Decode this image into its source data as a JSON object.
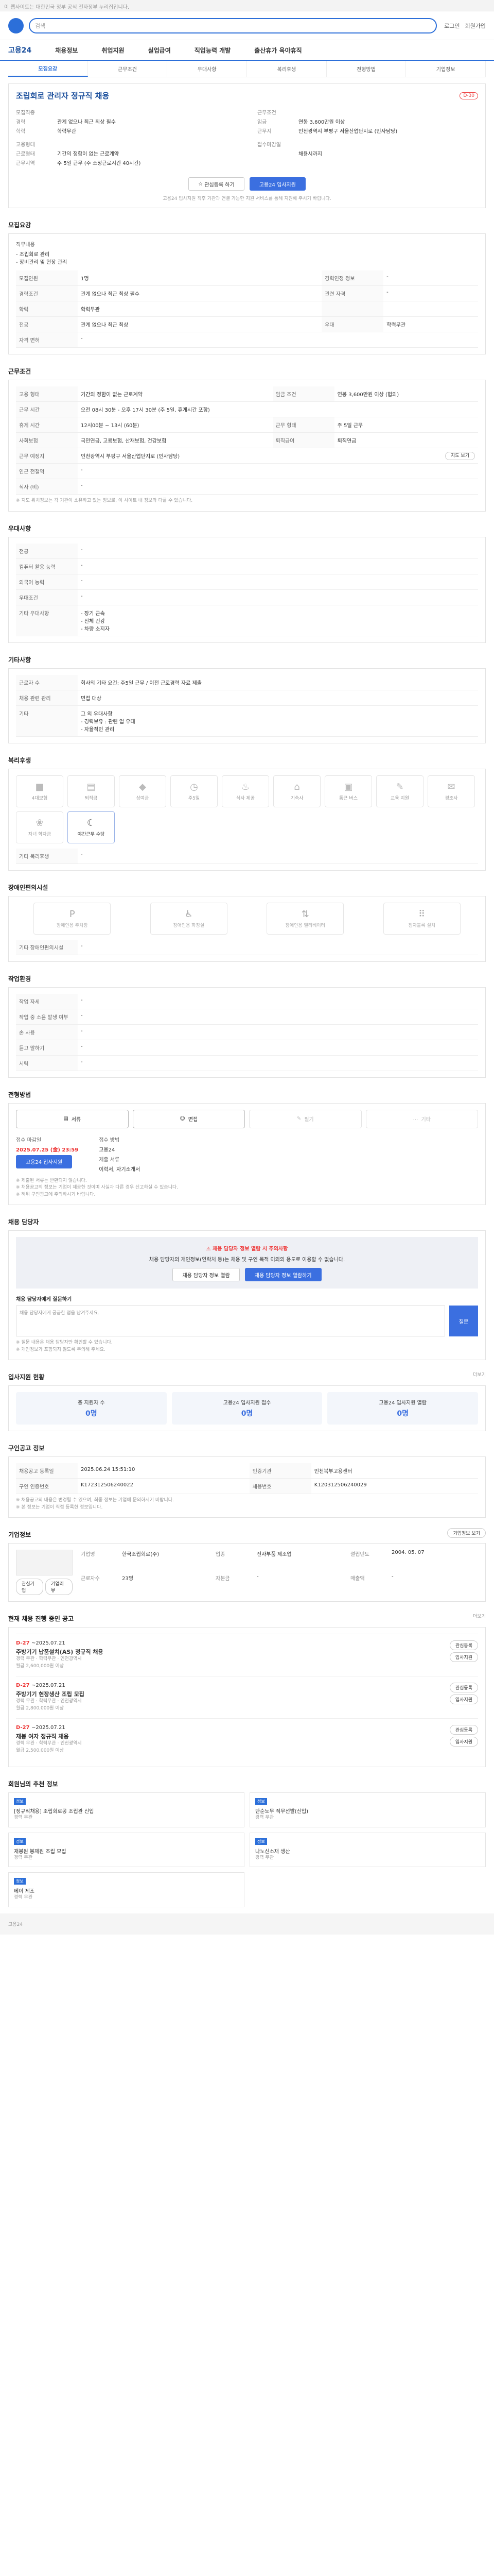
{
  "topbar": {
    "text": "이 웹사이트는 대한민국 정부 공식 전자정부 누리집입니다."
  },
  "header": {
    "search_placeholder": "검색",
    "links": [
      "로그인",
      "회원가입"
    ]
  },
  "nav": {
    "brand": "고용24",
    "items": [
      "채용정보",
      "취업지원",
      "실업급여",
      "직업능력 개발",
      "출산휴가 육아휴직"
    ]
  },
  "tabs": [
    "모집요강",
    "근무조건",
    "우대사항",
    "복리후생",
    "전형방법",
    "기업정보"
  ],
  "job": {
    "title": "조립회로 관리자 정규직 채용",
    "badge": "D-30",
    "left": [
      {
        "k": "모집직종",
        "v": ""
      },
      {
        "k": "경력",
        "v": "관계 없으나 최근 최상 필수"
      },
      {
        "k": "학력",
        "v": "학력무관"
      }
    ],
    "left2": [
      {
        "k": "고용형태",
        "v": ""
      },
      {
        "k": "근로형태",
        "v": "기간의 정함이 없는 근로계약"
      },
      {
        "k": "근무지역",
        "v": "주 5일 근무 (주 소정근로시간 40시간)"
      }
    ],
    "right": [
      {
        "k": "근무조건",
        "v": ""
      },
      {
        "k": "임금",
        "v": "연봉 3,600만원 이상"
      },
      {
        "k": "근무지",
        "v": "인천광역시 부평구 서울산업단지로 (인사담당)"
      }
    ],
    "right2": [
      {
        "k": "접수마감일",
        "v": ""
      },
      {
        "k": "",
        "v": "채용시까지"
      }
    ],
    "btn_interest": "관심등록 하기",
    "btn_apply": "고용24 입사지원",
    "note": "고용24 입사지원 직후 기관과 연결 가능한 지원 서비스를 통해 지원해 주시기 바랍니다."
  },
  "recruit": {
    "title": "모집요강",
    "duties_k": "직무내용",
    "duties": [
      "- 조립회로 관리",
      "- 장비관리 및 현장 관리"
    ],
    "rows": [
      {
        "k": "모집인원",
        "v": "1명",
        "k2": "경력인정 정보",
        "v2": "-"
      },
      {
        "k": "경력조건",
        "v": "관계 없으나 최근 최상 필수",
        "k2": "관련 자격",
        "v2": "-"
      },
      {
        "k": "학력",
        "v": "학력무관",
        "k2": "",
        "v2": ""
      },
      {
        "k": "전공",
        "v": "관계 없으나 최근 최상",
        "k2": "우대",
        "v2": "학력무관"
      },
      {
        "k": "자격 면허",
        "v": "-",
        "k2": "",
        "v2": ""
      }
    ]
  },
  "conditions": {
    "title": "근무조건",
    "rows": [
      {
        "k": "고용 형태",
        "v": "기간의 정함이 없는 근로계약",
        "k2": "임금 조건",
        "v2": "연봉 3,600만원 이상 (협의)"
      },
      {
        "k": "근무 시간",
        "v": "오전 08시 30분 - 오후 17시 30분 (주 5일, 휴게시간 포함)",
        "k2": "",
        "v2": ""
      },
      {
        "k": "휴게 시간",
        "v": "12시00분 ~ 13시 (60분)",
        "k2": "근무 형태",
        "v2": "주 5일 근무"
      },
      {
        "k": "사회보험",
        "v": "국민연금, 고용보험, 산재보험, 건강보험",
        "k2": "퇴직급여",
        "v2": "퇴직연금"
      },
      {
        "k": "근무 예정지",
        "v": "인천광역시 부평구 서울산업단지로 (인사담당)",
        "k2": "",
        "v2": ""
      },
      {
        "k": "인근 전철역",
        "v": "-",
        "k2": "",
        "v2": ""
      },
      {
        "k": "식사 (비)",
        "v": "-",
        "k2": "",
        "v2": ""
      }
    ],
    "map_btn": "지도 보기",
    "note": "※ 지도 위치정보는 각 기관이 소유하고 있는 정보로, 이 사이트 내 정보와 다를 수 있습니다."
  },
  "prefer": {
    "title": "우대사항",
    "rows": [
      {
        "k": "전공",
        "v": "-"
      },
      {
        "k": "컴퓨터 활용 능력",
        "v": "-"
      },
      {
        "k": "외국어 능력",
        "v": "-"
      },
      {
        "k": "우대조건",
        "v": "-"
      },
      {
        "k": "기타 우대사항",
        "v": "- 장기 근속\n- 신체 건강\n- 차량 소지자"
      }
    ]
  },
  "other": {
    "title": "기타사항",
    "rows": [
      {
        "k": "근로자 수",
        "v": "회사의 기타 요건: 주5일 근무 / 이전 근로경력 자료 제출"
      },
      {
        "k": "채용 관련 관리",
        "v": "면접 대상"
      },
      {
        "k": "기타",
        "v": "그 외 우대사항\n- 경력보유 : 관련 업 우대\n- 자율적인 관리"
      }
    ]
  },
  "benefits": {
    "title": "복리후생",
    "items": [
      {
        "label": "4대보험",
        "icon": "■",
        "on": false
      },
      {
        "label": "퇴직금",
        "icon": "▤",
        "on": false
      },
      {
        "label": "상여금",
        "icon": "◆",
        "on": false
      },
      {
        "label": "주5일",
        "icon": "◷",
        "on": false
      },
      {
        "label": "식사 제공",
        "icon": "♨",
        "on": false
      },
      {
        "label": "기숙사",
        "icon": "⌂",
        "on": false
      },
      {
        "label": "통근 버스",
        "icon": "▣",
        "on": false
      },
      {
        "label": "교육 지원",
        "icon": "✎",
        "on": false
      },
      {
        "label": "경조사",
        "icon": "✉",
        "on": false
      },
      {
        "label": "자녀 학자금",
        "icon": "❀",
        "on": false
      },
      {
        "label": "야간근무 수당",
        "icon": "☾",
        "on": true
      }
    ],
    "other_k": "기타 복리후생",
    "other_v": "-"
  },
  "facility": {
    "title": "장애인편의시설",
    "items": [
      "장애인용 주차장",
      "장애인용 화장실",
      "장애인용 엘리베이터",
      "점자블록 설치"
    ],
    "other_k": "기타 장애인편의시설",
    "other_v": "-"
  },
  "workenv": {
    "title": "작업환경",
    "rows": [
      {
        "k": "작업 자세",
        "v": "-",
        "k2": "",
        "v2": ""
      },
      {
        "k": "작업 중 소음 발생 여부",
        "v": "-",
        "k2": "",
        "v2": ""
      },
      {
        "k": "손 사용",
        "v": "-",
        "k2": "",
        "v2": ""
      },
      {
        "k": "듣고 말하기",
        "v": "-",
        "k2": "",
        "v2": ""
      },
      {
        "k": "시력",
        "v": "-",
        "k2": "",
        "v2": ""
      }
    ]
  },
  "selection": {
    "title": "전형방법",
    "methods": [
      {
        "label": "서류",
        "icon": "▤",
        "on": true
      },
      {
        "label": "면접",
        "icon": "☺",
        "on": true
      },
      {
        "label": "필기",
        "icon": "✎",
        "on": false
      },
      {
        "label": "기타",
        "icon": "…",
        "on": false
      }
    ],
    "deadline_k": "접수 마감일",
    "deadline_v": "2025.07.25 (金) 23:59",
    "apply_k": "접수 방법",
    "apply_v": "고용24",
    "docs_k": "제출 서류",
    "docs_v": "이력서, 자기소개서",
    "btn": "고용24 입사지원",
    "notes": "※ 제출된 서류는 반환되지 않습니다.\n※ 채용공고의 정보는 기업이 제공한 것이며 사실과 다른 경우 신고하실 수 있습니다.\n※ 허위 구인광고에 주의하시기 바랍니다."
  },
  "manager": {
    "title": "채용 담당자",
    "warn_t": "채용 담당자 정보 열람 시 주의사항",
    "warn_v": "채용 담당자의 개인정보(연락처 등)는 채용 및 구인 목적 이외의 용도로 이용할 수 없습니다.",
    "btn1": "채용 담당자 정보 열람",
    "btn2": "채용 담당자 정보 열람하기",
    "qa_title": "채용 담당자에게 질문하기",
    "qa_placeholder": "채용 담당자에게 궁금한 점을 남겨주세요.",
    "qa_btn": "질문",
    "qa_notes": "※ 질문 내용은 채용 담당자만 확인할 수 있습니다.\n※ 개인정보가 포함되지 않도록 주의해 주세요."
  },
  "status": {
    "title": "입사지원 현황",
    "more": "더보기",
    "items": [
      {
        "label": "총 지원자 수",
        "n": "0명"
      },
      {
        "label": "고용24 입사지원 접수",
        "n": "0명"
      },
      {
        "label": "고용24 입사지원 열람",
        "n": "0명"
      }
    ]
  },
  "posting": {
    "title": "구인공고 정보",
    "rows": [
      {
        "k": "채용공고 등록일",
        "v": "2025.06.24 15:51:10",
        "k2": "인증기관",
        "v2": "인천북부고용센터"
      },
      {
        "k": "구인 인증번호",
        "v": "K172312506240022",
        "k2": "채용번호",
        "v2": "K120312506240029"
      }
    ],
    "notes": "※ 채용공고의 내용은 변경될 수 있으며, 최종 정보는 기업에 문의하시기 바랍니다.\n※ 본 정보는 기업이 직접 등록한 정보입니다."
  },
  "company": {
    "title": "기업정보",
    "btn_more": "기업정보 보기",
    "fields": [
      {
        "k": "기업명",
        "v": "한국조립회로(주)"
      },
      {
        "k": "업종",
        "v": "전자부품 제조업"
      },
      {
        "k": "설립년도",
        "v": "2004. 05. 07"
      },
      {
        "k": "근로자수",
        "v": "23명"
      },
      {
        "k": "자본금",
        "v": "-"
      },
      {
        "k": "매출액",
        "v": "-"
      }
    ],
    "actions": [
      "관심기업",
      "기업리뷰"
    ]
  },
  "related": {
    "title": "현재 채용 진행 중인 공고",
    "more": "더보기",
    "items": [
      {
        "d": "D-27",
        "date": "~2025.07.21",
        "t": "주방기기 납품설치(AS) 정규직 채용",
        "meta": "경력 무관 · 학력무관 · 인천광역시",
        "pay": "월급 2,600,000원 이상"
      },
      {
        "d": "D-27",
        "date": "~2025.07.21",
        "t": "주방기기 현장생산 조립 모집",
        "meta": "경력 무관 · 학력무관 · 인천광역시",
        "pay": "월급 2,800,000원 이상"
      },
      {
        "d": "D-27",
        "date": "~2025.07.21",
        "t": "재봉 여자 정규직 채용",
        "meta": "경력 무관 · 학력무관 · 인천광역시",
        "pay": "월급 2,500,000원 이상"
      }
    ],
    "btns": [
      "관심등록",
      "입사지원"
    ]
  },
  "recommend": {
    "title": "회원님의 추천 정보",
    "items": [
      {
        "tag": "정보",
        "t": "[정규직채용] 조립회로공 조립관 신입",
        "s": "경력 무관"
      },
      {
        "tag": "정보",
        "t": "단순노무 직무선발(신입)",
        "s": "경력 무관"
      },
      {
        "tag": "정보",
        "t": "재봉원 봉제원 조립 모집",
        "s": "경력 무관"
      },
      {
        "tag": "정보",
        "t": "나노신소재 생산",
        "s": "경력 무관"
      },
      {
        "tag": "정보",
        "t": "베이 제조",
        "s": "경력 무관"
      }
    ]
  },
  "colors": {
    "primary": "#3b6fe0",
    "accent": "#e33"
  }
}
